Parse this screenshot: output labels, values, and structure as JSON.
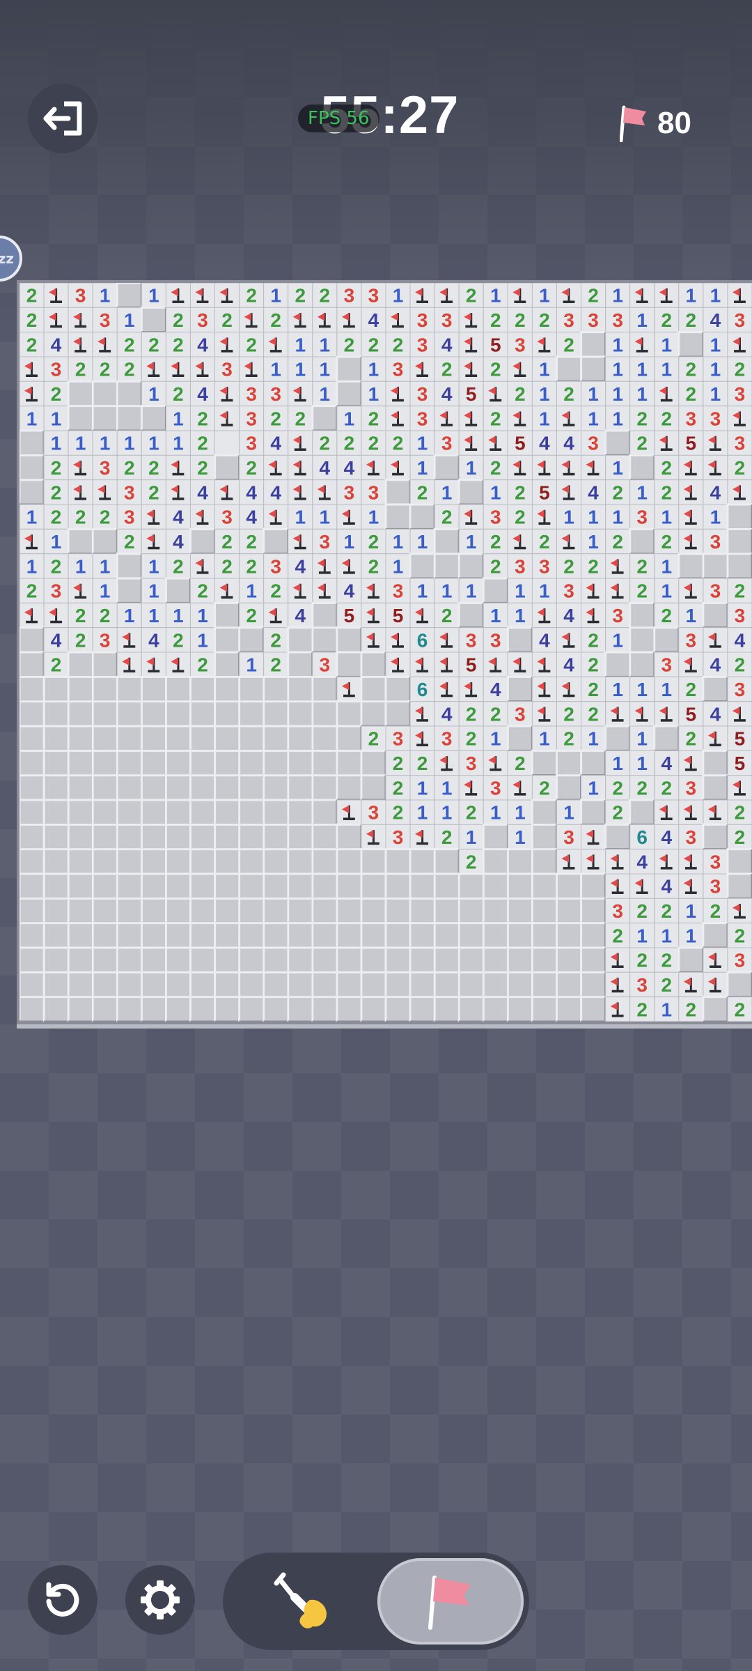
{
  "header": {
    "timer": "55:27",
    "fps_label": "FPS 56",
    "flags_remaining": "80",
    "sleep_badge": "zz"
  },
  "board": {
    "cols": 30,
    "rows": 30,
    "grid": [
      "2F31 1FFF2122331FF21F1F21FF11F211",
      "2FF31 232F2FFF4F33F22233312243F3",
      "24FF2224F2F1122234F53F2 1F1 1F43FF",
      "F3222FFF3F111 13F2F2F1  111212133F4",
      "F2   124F33F1 1F345F212111F2133F",
      "11    12F322 12F3FF2F1F112233F4F3",
      " 1111112034F222213FF5443 2F5F3F3",
      " 2F322F2 2FF44FF1 12FFFF1 2FF24F4F",
      " 2FF32F4F44FF33 21 125F4212F4F42",
      "12223F4F34F11F1  2F32F11131F1",
      "F1  2F4 22 F31211 12F2F12 2F3 21",
      "1211 12F2234FF21   23322F21",
      "23F1 1 2F12FF4F3111 113FF21F32211",
      "FF221111 2F4 5F5F2 11F4F3 21 3F3F1",
      " 423F421  2   FF6F33 4F21  3F411",
      " 2  FFF2 12 3  FFF5FFF42  3F42",
      "             F  6FF4 FF21112 3FF2",
      "                F4223F22FFF54F32",
      "              23F321 121 1 2F5FFF3F3",
      "               22F3F2   114F 5 4FF2",
      "               211F3F2 12223 FF2221",
      "             F3211211 1 2 FFF222211",
      "              F3F21 1 3F 643 222F1",
      "                  2   FFF4FF3 11",
      "                        FF4F3 11",
      "                        32212F1",
      "                        2111 2222",
      "                        F22 F3F2F",
      "                        F32FF 21",
      "                        F212 21"
    ]
  },
  "controls": {
    "exit": "exit-icon",
    "undo": "undo-icon",
    "settings": "gear-icon",
    "dig": "shovel-icon",
    "flag": "flag-icon",
    "active_tool": "flag"
  },
  "colors": {
    "1": "#3a5ec9",
    "2": "#3d9a3d",
    "3": "#d9443a",
    "4": "#3b3f9e",
    "5": "#8f1f1f",
    "6": "#1f8a8f",
    "flag": "#e24a4a",
    "flag_count": "#f08ca0",
    "fps": "#3ec25a"
  }
}
